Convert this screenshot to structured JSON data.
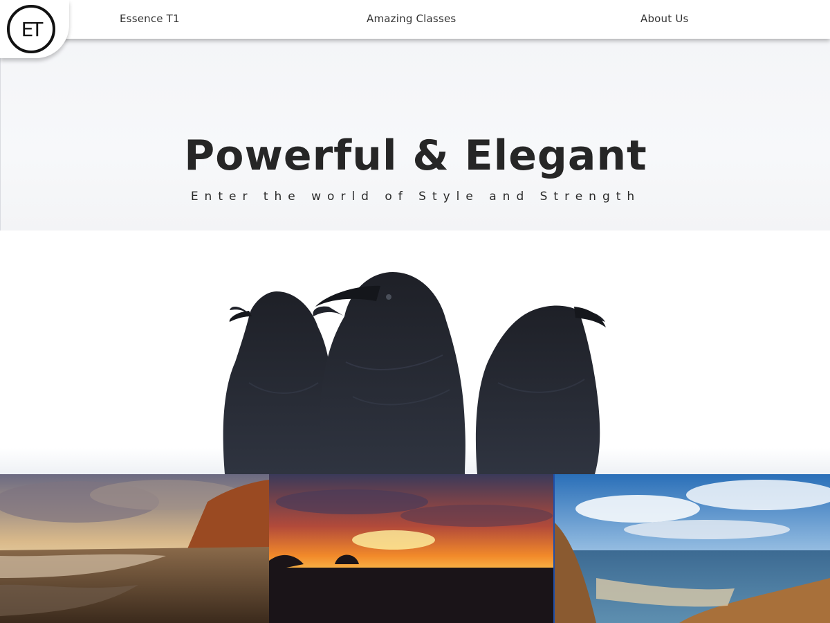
{
  "logo": {
    "text": "ET"
  },
  "nav": {
    "links": [
      {
        "label": "Essence T1"
      },
      {
        "label": "Amazing Classes"
      },
      {
        "label": "About Us"
      }
    ]
  },
  "hero": {
    "title": "Powerful & Elegant",
    "subtitle": "Enter the world of Style and Strength"
  },
  "colors": {
    "text": "#262626",
    "nav_bg": "#ffffff",
    "hero_bg": "#f5f6f8"
  },
  "images": {
    "birds": "three-ravens",
    "gallery": [
      "beach-cliff-sunset",
      "orange-sunset-silhouette",
      "coastal-cliff-blue-sky"
    ]
  }
}
